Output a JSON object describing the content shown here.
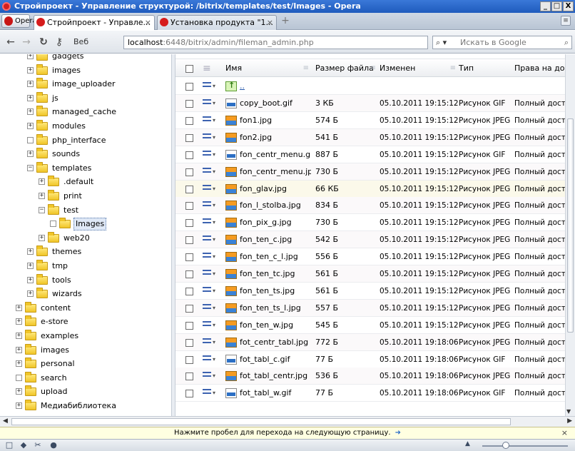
{
  "window": {
    "title": "Стройпроект - Управление структурой: /bitrix/templates/test/Images - Opera",
    "controls": {
      "minimize": "_",
      "maximize": "□",
      "close": "X"
    }
  },
  "tabs": {
    "opera_label": "Opera",
    "items": [
      {
        "label": "Стройпроект - Управле...",
        "close": "×",
        "active": true
      },
      {
        "label": "Установка продукта \"1...",
        "close": "×",
        "active": false
      }
    ],
    "new_tab": "+",
    "menu": "≡"
  },
  "nav": {
    "back": "←",
    "forward": "→",
    "reload": "↻",
    "key": "⚷",
    "web_badge": "Веб",
    "address_host": "localhost",
    "address_path": ":6448/bitrix/admin/fileman_admin.php",
    "search_engine": "▾",
    "search_placeholder": "Искать в Google",
    "search_go": "⌕"
  },
  "tree": {
    "items": [
      {
        "label": "gadgets",
        "expander": "+"
      },
      {
        "label": "images",
        "expander": "+"
      },
      {
        "label": "image_uploader",
        "expander": "+"
      },
      {
        "label": "js",
        "expander": "+"
      },
      {
        "label": "managed_cache",
        "expander": "+"
      },
      {
        "label": "modules",
        "expander": "+"
      },
      {
        "label": "php_interface",
        "expander": " "
      },
      {
        "label": "sounds",
        "expander": "+"
      },
      {
        "label": "templates",
        "expander": "−"
      },
      {
        "label": ".default",
        "expander": "+"
      },
      {
        "label": "print",
        "expander": "+"
      },
      {
        "label": "test",
        "expander": "−"
      },
      {
        "label": "Images",
        "expander": " "
      },
      {
        "label": "web20",
        "expander": "+"
      },
      {
        "label": "themes",
        "expander": "+"
      },
      {
        "label": "tmp",
        "expander": "+"
      },
      {
        "label": "tools",
        "expander": "+"
      },
      {
        "label": "wizards",
        "expander": "+"
      },
      {
        "label": "content",
        "expander": "+"
      },
      {
        "label": "e-store",
        "expander": "+"
      },
      {
        "label": "examples",
        "expander": "+"
      },
      {
        "label": "images",
        "expander": "+"
      },
      {
        "label": "personal",
        "expander": "+"
      },
      {
        "label": "search",
        "expander": " "
      },
      {
        "label": "upload",
        "expander": "+"
      },
      {
        "label": "Медиабиблиотека",
        "expander": "+"
      }
    ]
  },
  "table": {
    "headers": {
      "name": "Имя",
      "size": "Размер файла",
      "modified": "Изменен",
      "type": "Тип",
      "rights": "Права на дост"
    },
    "up_link": "..",
    "rows": [
      {
        "name": "copy_boot.gif",
        "size": "3 КБ",
        "modified": "05.10.2011 19:15:12",
        "type": "Рисунок GIF",
        "rights": "Полный доступ",
        "icon": "gif"
      },
      {
        "name": "fon1.jpg",
        "size": "574 Б",
        "modified": "05.10.2011 19:15:12",
        "type": "Рисунок JPEG",
        "rights": "Полный доступ",
        "icon": "jpg"
      },
      {
        "name": "fon2.jpg",
        "size": "541 Б",
        "modified": "05.10.2011 19:15:12",
        "type": "Рисунок JPEG",
        "rights": "Полный доступ",
        "icon": "jpg"
      },
      {
        "name": "fon_centr_menu.gif",
        "size": "887 Б",
        "modified": "05.10.2011 19:15:12",
        "type": "Рисунок GIF",
        "rights": "Полный доступ",
        "icon": "gif"
      },
      {
        "name": "fon_centr_menu.jpg",
        "size": "730 Б",
        "modified": "05.10.2011 19:15:12",
        "type": "Рисунок JPEG",
        "rights": "Полный доступ",
        "icon": "jpg"
      },
      {
        "name": "fon_glav.jpg",
        "size": "66 КБ",
        "modified": "05.10.2011 19:15:12",
        "type": "Рисунок JPEG",
        "rights": "Полный доступ",
        "icon": "jpg"
      },
      {
        "name": "fon_l_stolba.jpg",
        "size": "834 Б",
        "modified": "05.10.2011 19:15:12",
        "type": "Рисунок JPEG",
        "rights": "Полный доступ",
        "icon": "jpg"
      },
      {
        "name": "fon_pix_g.jpg",
        "size": "730 Б",
        "modified": "05.10.2011 19:15:12",
        "type": "Рисунок JPEG",
        "rights": "Полный доступ",
        "icon": "jpg"
      },
      {
        "name": "fon_ten_c.jpg",
        "size": "542 Б",
        "modified": "05.10.2011 19:15:12",
        "type": "Рисунок JPEG",
        "rights": "Полный доступ",
        "icon": "jpg"
      },
      {
        "name": "fon_ten_c_l.jpg",
        "size": "556 Б",
        "modified": "05.10.2011 19:15:12",
        "type": "Рисунок JPEG",
        "rights": "Полный доступ",
        "icon": "jpg"
      },
      {
        "name": "fon_ten_tc.jpg",
        "size": "561 Б",
        "modified": "05.10.2011 19:15:12",
        "type": "Рисунок JPEG",
        "rights": "Полный доступ",
        "icon": "jpg"
      },
      {
        "name": "fon_ten_ts.jpg",
        "size": "561 Б",
        "modified": "05.10.2011 19:15:12",
        "type": "Рисунок JPEG",
        "rights": "Полный доступ",
        "icon": "jpg"
      },
      {
        "name": "fon_ten_ts_l.jpg",
        "size": "557 Б",
        "modified": "05.10.2011 19:15:12",
        "type": "Рисунок JPEG",
        "rights": "Полный доступ",
        "icon": "jpg"
      },
      {
        "name": "fon_ten_w.jpg",
        "size": "545 Б",
        "modified": "05.10.2011 19:15:12",
        "type": "Рисунок JPEG",
        "rights": "Полный доступ",
        "icon": "jpg"
      },
      {
        "name": "fot_centr_tabl.jpg",
        "size": "772 Б",
        "modified": "05.10.2011 19:18:06",
        "type": "Рисунок JPEG",
        "rights": "Полный доступ",
        "icon": "jpg"
      },
      {
        "name": "fot_tabl_c.gif",
        "size": "77 Б",
        "modified": "05.10.2011 19:18:06",
        "type": "Рисунок GIF",
        "rights": "Полный доступ",
        "icon": "gif"
      },
      {
        "name": "fot_tabl_centr.jpg",
        "size": "536 Б",
        "modified": "05.10.2011 19:18:06",
        "type": "Рисунок JPEG",
        "rights": "Полный доступ",
        "icon": "jpg"
      },
      {
        "name": "fot_tabl_w.gif",
        "size": "77 Б",
        "modified": "05.10.2011 19:18:06",
        "type": "Рисунок GIF",
        "rights": "Полный доступ",
        "icon": "gif"
      }
    ]
  },
  "infobar": {
    "text": "Нажмите пробел для перехода на следующую страницу.",
    "arrow": "➜",
    "close": "×"
  },
  "statusbar": {
    "icons": [
      "□",
      "◆",
      "✂",
      "●"
    ],
    "zoom_arrow": "▲"
  }
}
